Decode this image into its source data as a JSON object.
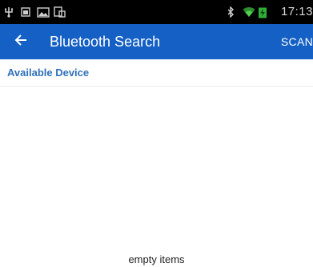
{
  "status_bar": {
    "time": "17:13",
    "icons": [
      "usb-icon",
      "sim-icon",
      "image-icon",
      "screen-icon",
      "bluetooth-icon",
      "wifi-icon",
      "battery-icon"
    ]
  },
  "toolbar": {
    "title": "Bluetooth Search",
    "scan_label": "SCAN",
    "background_color": "#1560c5"
  },
  "section": {
    "label": "Available Device",
    "label_color": "#2e70ba"
  },
  "device_list": {
    "items": [],
    "empty_text": "empty items"
  }
}
